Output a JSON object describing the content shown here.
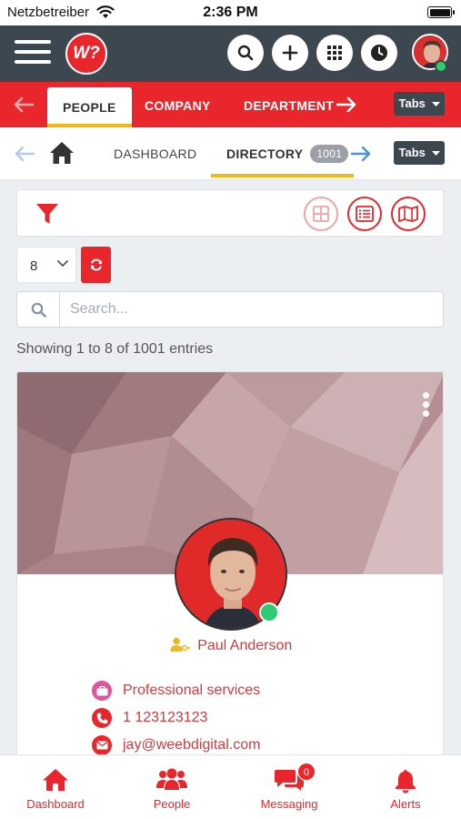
{
  "status_bar": {
    "carrier": "Netzbetreiber",
    "time": "2:36 PM"
  },
  "header": {
    "logo_text": "W?",
    "icons": [
      "menu-icon",
      "search-icon",
      "plus-icon",
      "apps-grid-icon",
      "clock-icon"
    ]
  },
  "primary_tabs": {
    "items": [
      {
        "label": "PEOPLE",
        "active": true
      },
      {
        "label": "COMPANY",
        "active": false
      },
      {
        "label": "DEPARTMENT",
        "active": false
      }
    ],
    "dropdown_label": "Tabs"
  },
  "secondary_tabs": {
    "items": [
      {
        "label": "DASHBOARD",
        "active": false
      },
      {
        "label": "DIRECTORY",
        "active": true,
        "count": "1001"
      }
    ],
    "dropdown_label": "Tabs"
  },
  "toolbar": {
    "page_size": "8",
    "view_modes": [
      "grid-view",
      "list-view",
      "map-view"
    ],
    "active_view": "list-view"
  },
  "search": {
    "placeholder": "Search...",
    "value": ""
  },
  "entries_info": "Showing 1 to 8 of 1001 entries",
  "profile": {
    "name": "Paul Anderson",
    "industry": "Professional services",
    "phone": "1 123123123",
    "email": "jay@weebdigital.com",
    "online": true
  },
  "bottom_nav": [
    {
      "label": "Dashboard",
      "icon": "home-icon"
    },
    {
      "label": "People",
      "icon": "people-icon"
    },
    {
      "label": "Messaging",
      "icon": "chat-icon",
      "badge": "0"
    },
    {
      "label": "Alerts",
      "icon": "bell-icon"
    }
  ],
  "colors": {
    "primary": "#e8262b",
    "header": "#3c474f",
    "accent": "#f2b71c",
    "online": "#2ecc71"
  }
}
